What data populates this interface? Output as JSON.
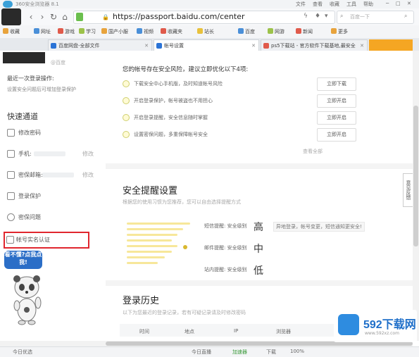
{
  "titlebar": {
    "title": "360安全浏览器 8.1",
    "controls": [
      "文件",
      "查看",
      "收藏",
      "工具",
      "帮助"
    ]
  },
  "navbar": {
    "url": "https://passport.baidu.com/center",
    "search_placeholder": "百度一下"
  },
  "bookmarks": [
    "收藏",
    "网址",
    "游戏",
    "学习",
    "国产小服",
    "视频",
    "收藏夹",
    "站长",
    "百度",
    "网游",
    "新闻",
    "更多"
  ],
  "tabs": [
    {
      "label": "百度网盘-全部文件",
      "active": false
    },
    {
      "label": "帐号设置",
      "active": true
    },
    {
      "label": "ps5下载站 - 官方软件下载基地,最安全",
      "active": false
    }
  ],
  "sidebar": {
    "account_sub": "@百度",
    "sec_hint1": "最近一次登录操作:",
    "sec_hint2": "设置安全问题后可增加登录保护",
    "quick_title": "快速通道",
    "items": [
      {
        "label": "修改密码",
        "edit": ""
      },
      {
        "label": "手机:",
        "edit": "修改"
      },
      {
        "label": "密保邮箱:",
        "edit": "修改"
      },
      {
        "label": "登录保护",
        "edit": ""
      },
      {
        "label": "密保问题",
        "edit": ""
      },
      {
        "label": "帐号实名认证",
        "edit": ""
      }
    ],
    "mascot_bubble": "看不懂?点我点我!"
  },
  "main": {
    "intro": "您的帐号存在安全风险，建议立即优化以下4项:",
    "risks": [
      {
        "text": "下载安全中心手机版，及时知道帐号风险",
        "button": "立即下载"
      },
      {
        "text": "开启登录保护，帐号被盗也不用担心",
        "button": "立即开启"
      },
      {
        "text": "开启登录提醒，安全信息随时掌握",
        "button": "立即开启"
      },
      {
        "text": "设置密保问题，多重保障帐号安全",
        "button": "立即开启"
      }
    ],
    "view_all": "查看全部",
    "alert_title": "安全提醒设置",
    "alert_desc": "根据您的使用习惯为您推荐，您可以自由选择提醒方式",
    "levels": [
      {
        "label": "短信提醒: 安全级别",
        "value": "高",
        "tip": "异地登录，帐号变更，短信通知更安全!"
      },
      {
        "label": "邮件提醒: 安全级别",
        "value": "中",
        "tip": ""
      },
      {
        "label": "站内提醒: 安全级别",
        "value": "低",
        "tip": ""
      }
    ],
    "login_title": "登录历史",
    "login_desc": "以下为您最近的登录记录，若有可疑记录请及时修改密码",
    "login_columns": [
      "时间",
      "地点",
      "IP",
      "浏览器"
    ]
  },
  "feedback_label": "意见反馈",
  "statusbar": {
    "left": "今日优选",
    "items": [
      "今日直播",
      "加速器",
      "下载",
      "100%"
    ]
  },
  "watermark": {
    "brand": "592下载网",
    "sub": "www.592xz.com"
  }
}
